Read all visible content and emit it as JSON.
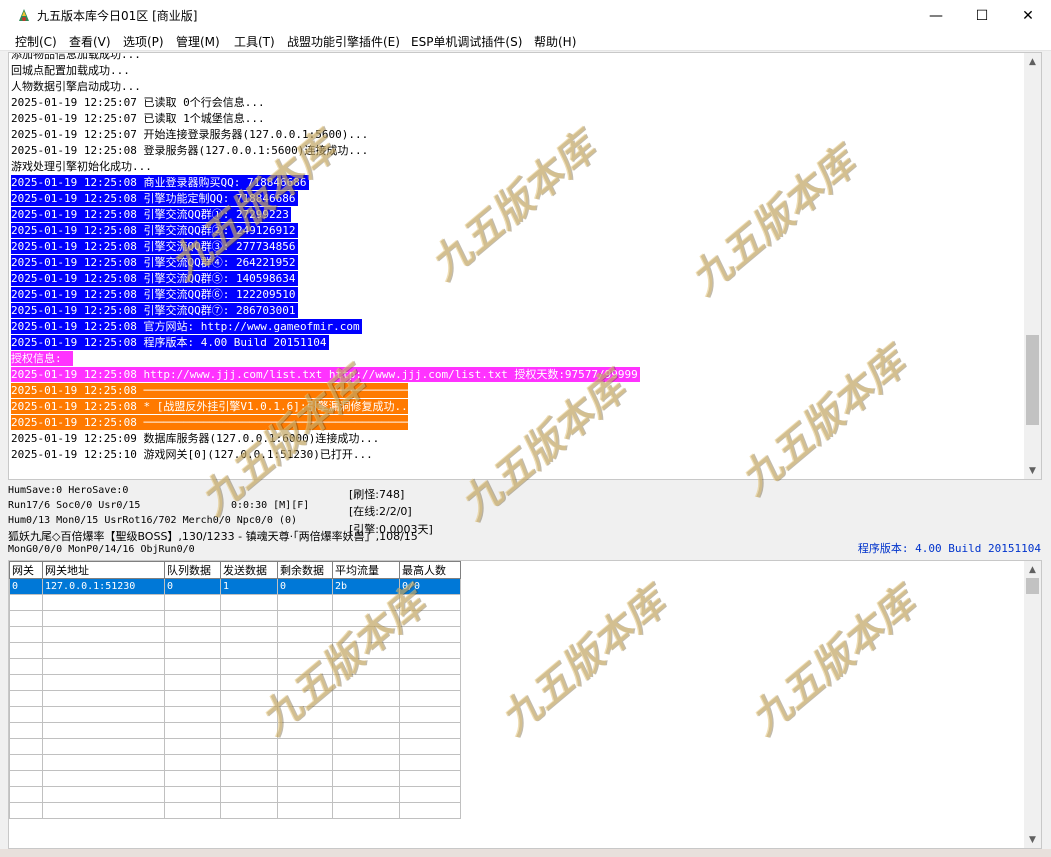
{
  "window": {
    "title": "九五版本库今日01区 [商业版]",
    "minimize_glyph": "—",
    "maximize_glyph": "☐",
    "close_glyph": "✕"
  },
  "menu": [
    "控制(C)",
    "查看(V)",
    "选项(P)",
    "管理(M)",
    "工具(T)",
    "战盟功能引擎插件(E)",
    "ESP单机调试插件(S)",
    "帮助(H)"
  ],
  "log": [
    {
      "text": "添加物品信息加载成功...",
      "style": "normal"
    },
    {
      "text": "回城点配置加载成功...",
      "style": "normal"
    },
    {
      "text": "人物数据引擎启动成功...",
      "style": "normal"
    },
    {
      "text": "2025-01-19 12:25:07 已读取 0个行会信息...",
      "style": "normal"
    },
    {
      "text": "2025-01-19 12:25:07 已读取 1个城堡信息...",
      "style": "normal"
    },
    {
      "text": "2025-01-19 12:25:07 开始连接登录服务器(127.0.0.1:5600)...",
      "style": "normal"
    },
    {
      "text": "2025-01-19 12:25:08 登录服务器(127.0.0.1:5600)连接成功...",
      "style": "normal"
    },
    {
      "text": "游戏处理引擎初始化成功...",
      "style": "normal"
    },
    {
      "text": "2025-01-19 12:25:08 商业登录器购买QQ: 718846686",
      "style": "blue"
    },
    {
      "text": "2025-01-19 12:25:08 引擎功能定制QQ: 718846686",
      "style": "blue"
    },
    {
      "text": "2025-01-19 12:25:08 引擎交流QQ群①: 27299223",
      "style": "blue"
    },
    {
      "text": "2025-01-19 12:25:08 引擎交流QQ群②: 249126912",
      "style": "blue"
    },
    {
      "text": "2025-01-19 12:25:08 引擎交流QQ群③: 277734856",
      "style": "blue"
    },
    {
      "text": "2025-01-19 12:25:08 引擎交流QQ群④: 264221952",
      "style": "blue"
    },
    {
      "text": "2025-01-19 12:25:08 引擎交流QQ群⑤: 140598634",
      "style": "blue"
    },
    {
      "text": "2025-01-19 12:25:08 引擎交流QQ群⑥: 122209510",
      "style": "blue"
    },
    {
      "text": "2025-01-19 12:25:08 引擎交流QQ群⑦: 286703001",
      "style": "blue"
    },
    {
      "text": "2025-01-19 12:25:08 官方网站: http://www.gameofmir.com",
      "style": "blue"
    },
    {
      "text": "2025-01-19 12:25:08 程序版本: 4.00 Build 20151104",
      "style": "blue"
    },
    {
      "text": "授权信息:",
      "style": "magenta"
    },
    {
      "text": "2025-01-19 12:25:08 http://www.jjj.com/list.txt http://www.jjj.com/list.txt 授权天数:97577/99999",
      "style": "magenta"
    },
    {
      "text": "2025-01-19 12:25:08 ──────────────────────────────────────────────",
      "style": "orange"
    },
    {
      "text": "2025-01-19 12:25:08 * [战盟反外挂引擎V1.0.1.6]:引擎漏洞修复成功...",
      "style": "orange"
    },
    {
      "text": "2025-01-19 12:25:08 ──────────────────────────────────────────────",
      "style": "orange"
    },
    {
      "text": "2025-01-19 12:25:09 数据库服务器(127.0.0.1:6000)连接成功...",
      "style": "normal"
    },
    {
      "text": "2025-01-19 12:25:10 游戏网关[0](127.0.0.1:51230)已打开...",
      "style": "normal"
    }
  ],
  "status": {
    "line1": "HumSave:0 HeroSave:0",
    "line2": "Run17/6 Soc0/0 Usr0/15",
    "line3": "Hum0/13 Mon0/15 UsrRot16/702 Merch0/0 Npc0/0 (0)",
    "line4": "狐妖九尾◇百倍爆率【聖级BOSS】,130/1233 - 镇魂天尊·「两倍爆率妖兽」,108/15",
    "line5": "MonG0/0/0 MonP0/14/16 ObjRun0/0",
    "time": "0:0:30 [M][F]",
    "refresh": "[刷怪:748]",
    "online": "[在线:2/2/0]",
    "engine": "[引擎:0.0003天]",
    "version": "程序版本: 4.00 Build 20151104"
  },
  "gate_table": {
    "headers": [
      "网关",
      "网关地址",
      "队列数据",
      "发送数据",
      "剩余数据",
      "平均流量",
      "最高人数"
    ],
    "rows": [
      [
        "0",
        "127.0.0.1:51230",
        "0",
        "1",
        "0",
        "2b",
        "0/0"
      ]
    ]
  },
  "watermark": {
    "text": "九五版本库",
    "url": "www.95bbk.com"
  },
  "colors": {
    "selection_blue": "#0000ff",
    "auth_magenta": "#ff33ff",
    "notice_orange": "#ff7a00",
    "row_selected": "#0078d7",
    "version_text": "#0033cc"
  }
}
